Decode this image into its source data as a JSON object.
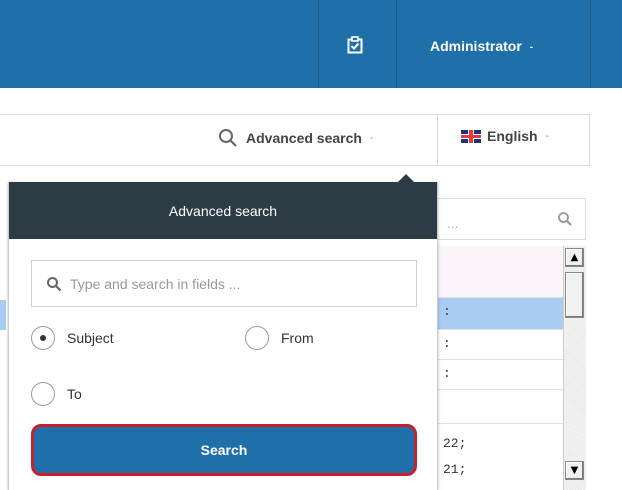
{
  "header": {
    "user_label": "Administrator",
    "caret": "-",
    "icon": "clipboard-check-icon",
    "bg_color": "#1f6fa8"
  },
  "toolbar": {
    "advanced_search_label": "Advanced search",
    "advanced_search_caret": "-",
    "language_label": "English",
    "language_caret": "-",
    "flag_icon": "uk-flag-icon"
  },
  "background": {
    "search_placeholder": "...",
    "rows": [
      {
        "text": ""
      },
      {
        "text": ":"
      },
      {
        "text": ":"
      },
      {
        "text": ":"
      },
      {
        "text": ""
      },
      {
        "text": "22;"
      },
      {
        "text": "21;"
      }
    ]
  },
  "advanced_search": {
    "title": "Advanced search",
    "placeholder": "Type and search in fields ...",
    "value": "",
    "options": [
      {
        "label": "Subject",
        "checked": true
      },
      {
        "label": "From",
        "checked": false
      },
      {
        "label": "To",
        "checked": false
      }
    ],
    "search_button": "Search",
    "header_color": "#2d3b45",
    "button_color": "#1f6fa8",
    "button_border_color": "#c8202a"
  }
}
